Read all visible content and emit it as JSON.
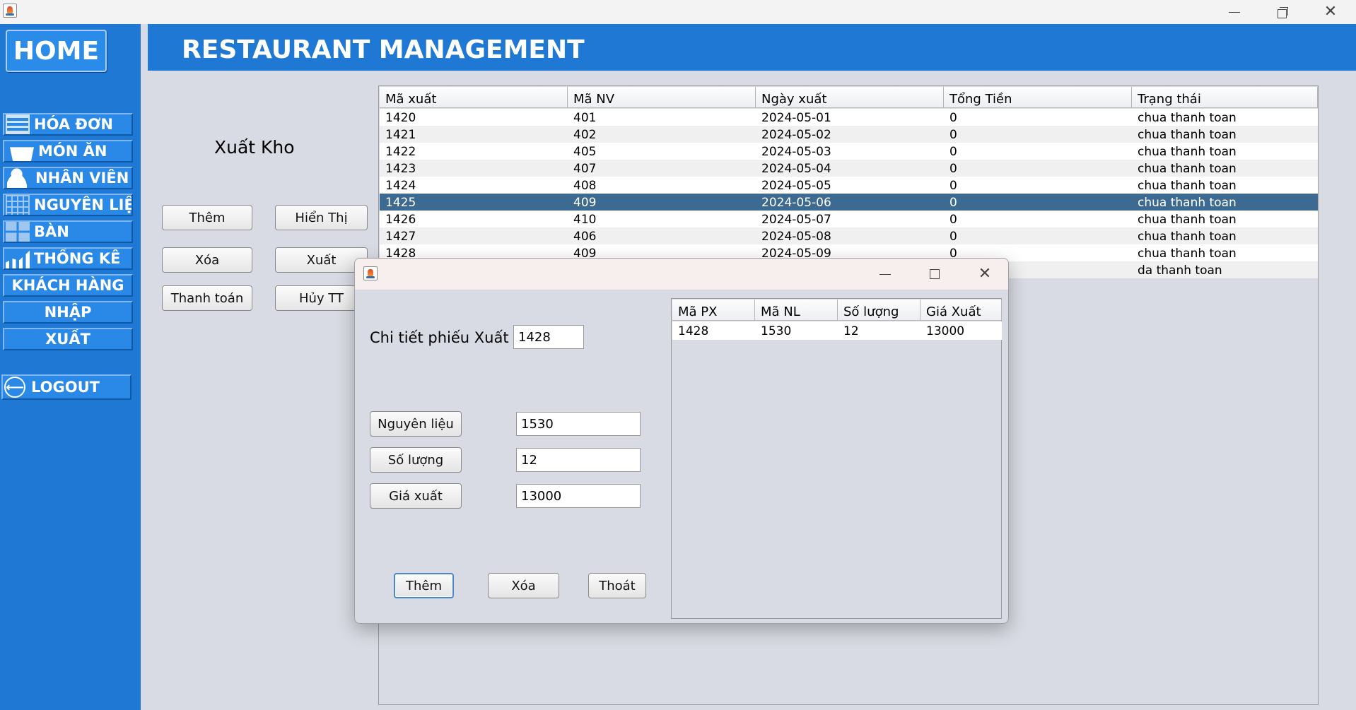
{
  "window": {
    "minimize_icon": "minimize-icon",
    "restore_icon": "restore-icon",
    "close_icon": "close-icon"
  },
  "sidebar": {
    "home_label": "HOME",
    "items": [
      {
        "label": "HÓA ĐƠN",
        "icon": "bill-icon"
      },
      {
        "label": "MÓN ĂN",
        "icon": "basket-icon"
      },
      {
        "label": "NHÂN VIÊN",
        "icon": "add-person-icon"
      },
      {
        "label": "NGUYÊN LIỆU",
        "icon": "ingredients-icon"
      },
      {
        "label": "BÀN",
        "icon": "table-icon"
      },
      {
        "label": "THỐNG KÊ",
        "icon": "chart-icon"
      },
      {
        "label": "KHÁCH HÀNG"
      },
      {
        "label": "NHẬP"
      },
      {
        "label": "XUẤT"
      }
    ],
    "logout_label": "LOGOUT"
  },
  "header": {
    "title": "RESTAURANT MANAGEMENT"
  },
  "main": {
    "heading": "Xuất Kho",
    "buttons": {
      "add": "Thêm",
      "show": "Hiển Thị",
      "delete": "Xóa",
      "export": "Xuất",
      "pay": "Thanh toán",
      "cancel_pay": "Hủy TT"
    },
    "table": {
      "columns": [
        "Mã xuất",
        "Mã NV",
        "Ngày xuất",
        "Tổng Tiền",
        "Trạng thái"
      ],
      "rows": [
        [
          "1420",
          "401",
          "2024-05-01",
          "0",
          "chua thanh toan"
        ],
        [
          "1421",
          "402",
          "2024-05-02",
          "0",
          "chua thanh toan"
        ],
        [
          "1422",
          "405",
          "2024-05-03",
          "0",
          "chua thanh toan"
        ],
        [
          "1423",
          "407",
          "2024-05-04",
          "0",
          "chua thanh toan"
        ],
        [
          "1424",
          "408",
          "2024-05-05",
          "0",
          "chua thanh toan"
        ],
        [
          "1425",
          "409",
          "2024-05-06",
          "0",
          "chua thanh toan"
        ],
        [
          "1426",
          "410",
          "2024-05-07",
          "0",
          "chua thanh toan"
        ],
        [
          "1427",
          "406",
          "2024-05-08",
          "0",
          "chua thanh toan"
        ],
        [
          "1428",
          "409",
          "2024-05-09",
          "0",
          "chua thanh toan"
        ],
        [
          "",
          "",
          "",
          "",
          "da thanh toan"
        ]
      ],
      "selected_row": 5
    }
  },
  "dialog": {
    "title_label": "Chi tiết phiếu Xuất",
    "receipt_id": "1428",
    "ingredient_label": "Nguyên liệu",
    "ingredient_value": "1530",
    "quantity_label": "Số lượng",
    "quantity_value": "12",
    "price_label": "Giá xuất",
    "price_value": "13000",
    "add_label": "Thêm",
    "delete_label": "Xóa",
    "exit_label": "Thoát",
    "table": {
      "columns": [
        "Mã PX",
        "Mã NL",
        "Số lượng",
        "Giá Xuất"
      ],
      "rows": [
        [
          "1428",
          "1530",
          "12",
          "13000"
        ]
      ]
    }
  }
}
